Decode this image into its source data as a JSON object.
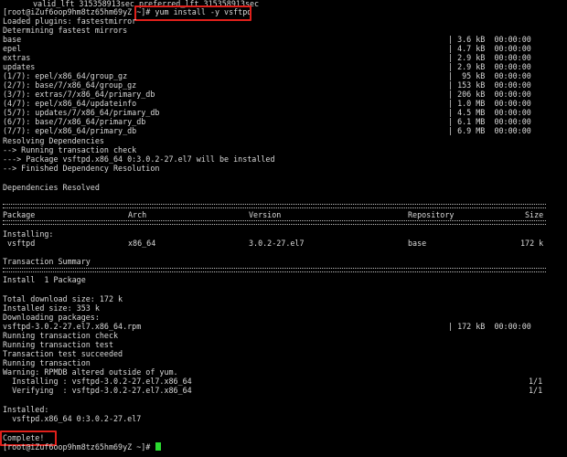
{
  "header_line": "valid_lft 315358913sec preferred_lft 315358913sec",
  "prompt": "[root@iZuf6oop9hm8tz65hm69yZ ~]#",
  "command": "yum install -y vsftpd",
  "loaded_plugins": "Loaded plugins: fastestmirror",
  "determining": "Determining fastest mirrors",
  "repos": [
    {
      "name": "base",
      "size": "3.6 kB",
      "time": "00:00:00"
    },
    {
      "name": "epel",
      "size": "4.7 kB",
      "time": "00:00:00"
    },
    {
      "name": "extras",
      "size": "2.9 kB",
      "time": "00:00:00"
    },
    {
      "name": "updates",
      "size": "2.9 kB",
      "time": "00:00:00"
    },
    {
      "name": "(1/7): epel/x86_64/group_gz",
      "size": " 95 kB",
      "time": "00:00:00"
    },
    {
      "name": "(2/7): base/7/x86_64/group_gz",
      "size": "153 kB",
      "time": "00:00:00"
    },
    {
      "name": "(3/7): extras/7/x86_64/primary_db",
      "size": "206 kB",
      "time": "00:00:00"
    },
    {
      "name": "(4/7): epel/x86_64/updateinfo",
      "size": "1.0 MB",
      "time": "00:00:00"
    },
    {
      "name": "(5/7): updates/7/x86_64/primary_db",
      "size": "4.5 MB",
      "time": "00:00:00"
    },
    {
      "name": "(6/7): base/7/x86_64/primary_db",
      "size": "6.1 MB",
      "time": "00:00:00"
    },
    {
      "name": "(7/7): epel/x86_64/primary_db",
      "size": "6.9 MB",
      "time": "00:00:00"
    }
  ],
  "resolving": [
    "Resolving Dependencies",
    "--> Running transaction check",
    "---> Package vsftpd.x86_64 0:3.0.2-27.el7 will be installed",
    "--> Finished Dependency Resolution"
  ],
  "deps_resolved": "Dependencies Resolved",
  "table": {
    "headers": {
      "package": "Package",
      "arch": "Arch",
      "version": "Version",
      "repository": "Repository",
      "size": "Size"
    },
    "installing_label": "Installing:",
    "row": {
      "package": "vsftpd",
      "arch": "x86_64",
      "version": "3.0.2-27.el7",
      "repository": "base",
      "size": "172 k"
    }
  },
  "transaction_summary": "Transaction Summary",
  "install_count": "Install  1 Package",
  "download": [
    "Total download size: 172 k",
    "Installed size: 353 k",
    "Downloading packages:"
  ],
  "rpm": {
    "name": "vsftpd-3.0.2-27.el7.x86_64.rpm",
    "size": "172 kB",
    "time": "00:00:00"
  },
  "transaction_lines": [
    "Running transaction check",
    "Running transaction test",
    "Transaction test succeeded",
    "Running transaction",
    "Warning: RPMDB altered outside of yum."
  ],
  "progress": [
    {
      "text": "  Installing : vsftpd-3.0.2-27.el7.x86_64",
      "count": "1/1"
    },
    {
      "text": "  Verifying  : vsftpd-3.0.2-27.el7.x86_64",
      "count": "1/1"
    }
  ],
  "installed_label": "Installed:",
  "installed_pkg": "  vsftpd.x86_64 0:3.0.2-27.el7",
  "complete": "Complete!",
  "final_prompt": "[root@iZuf6oop9hm8tz65hm69yZ ~]#",
  "colors": {
    "background": "#000000",
    "text": "#d9d9d9",
    "highlight": "#e0201b",
    "cursor": "#2bd930"
  }
}
